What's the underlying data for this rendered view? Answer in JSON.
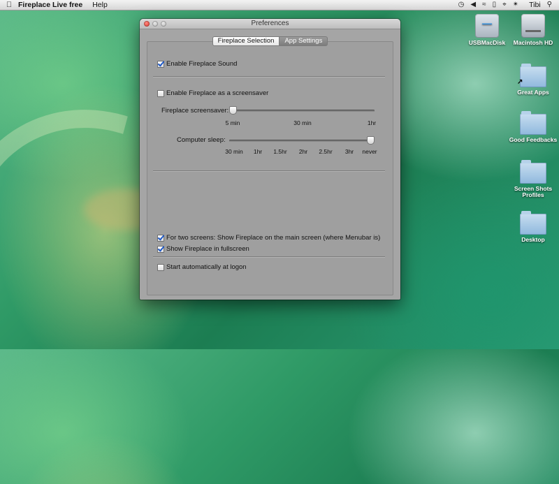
{
  "menubar": {
    "app_name": "Fireplace Live free",
    "menus": [
      "Help"
    ],
    "status_icons": [
      "time-machine-icon",
      "volume-icon",
      "wifi-icon",
      "battery-icon",
      "keyboard-icon",
      "bluetooth-icon",
      "search-icon"
    ],
    "user": "Tibi"
  },
  "window": {
    "title": "Preferences",
    "tabs": [
      "Fireplace Selection",
      "App Settings"
    ],
    "options": {
      "sound": "Enable Fireplace Sound",
      "screensaver": "Enable Fireplace as a screensaver",
      "two_screens": "For two screens: Show Fireplace on the main screen (where Menubar is)",
      "fullscreen": "Show Fireplace in fullscreen",
      "autostart": "Start automatically at logon"
    },
    "sliders": {
      "screensaver": {
        "label": "Fireplace screensaver:",
        "ticks": [
          "5 min",
          "30 min",
          "1hr"
        ],
        "value_index": 0
      },
      "sleep": {
        "label": "Computer sleep:",
        "ticks": [
          "30 min",
          "1hr",
          "1.5hr",
          "2hr",
          "2.5hr",
          "3hr",
          "never"
        ],
        "value_index": 6
      }
    }
  },
  "desktop": {
    "items": [
      "USBMacDisk",
      "Macintosh HD",
      "Great Apps",
      "Good Feedbacks",
      "Screen Shots Profiles",
      "Desktop"
    ]
  }
}
